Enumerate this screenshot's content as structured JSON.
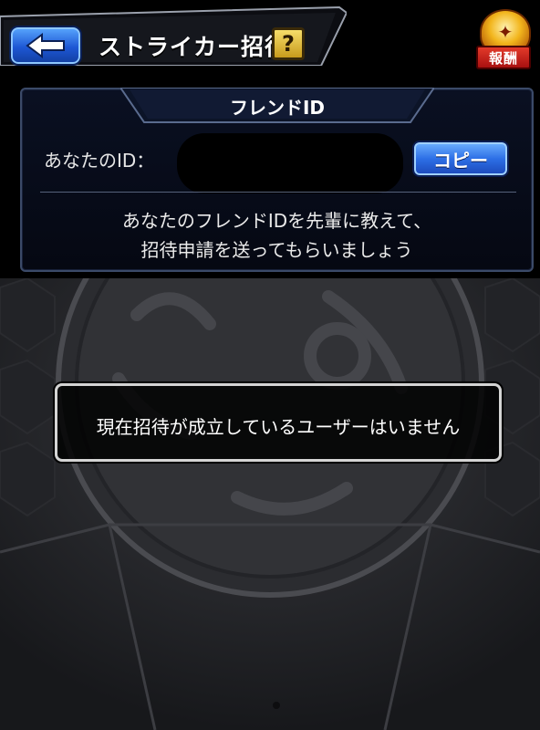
{
  "header": {
    "title": "ストライカー招待",
    "help_label": "?",
    "back_icon": "back-arrow-icon"
  },
  "reward_badge": {
    "label": "報酬",
    "icon": "reward-emblem-icon"
  },
  "friend_panel": {
    "title": "フレンドID",
    "id_label": "あなたのID：",
    "copy_label": "コピー",
    "message_line1": "あなたのフレンドIDを先輩に教えて、",
    "message_line2": "招待申請を送ってもらいましょう"
  },
  "status": {
    "message": "現在招待が成立しているユーザーはいません"
  },
  "colors": {
    "accent_blue": "#2d6fe6",
    "help_gold": "#e2b83a",
    "reward_red": "#c41a1a",
    "panel_border": "#3b4a68"
  }
}
